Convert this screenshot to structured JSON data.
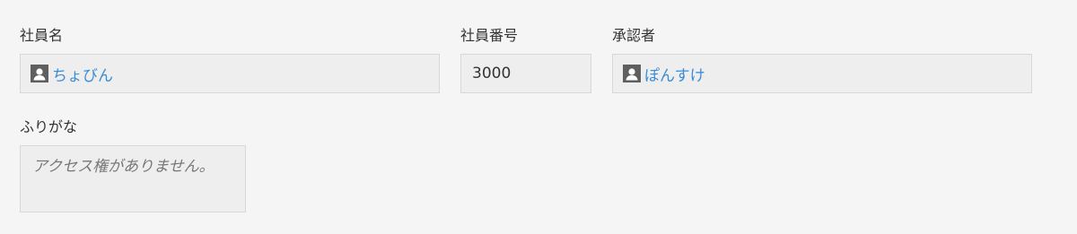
{
  "fields": {
    "employee_name": {
      "label": "社員名",
      "value": "ちょびん",
      "icon": "user-icon"
    },
    "employee_number": {
      "label": "社員番号",
      "value": "3000"
    },
    "approver": {
      "label": "承認者",
      "value": "ぽんすけ",
      "icon": "user-icon"
    },
    "furigana": {
      "label": "ふりがな",
      "value": "アクセス権がありません。"
    }
  },
  "colors": {
    "background": "#f5f5f5",
    "field_background": "#eeeeee",
    "field_border": "#d8d8d8",
    "link": "#3b8cd7",
    "muted_text": "#777777",
    "icon": "#5f5f5f"
  }
}
